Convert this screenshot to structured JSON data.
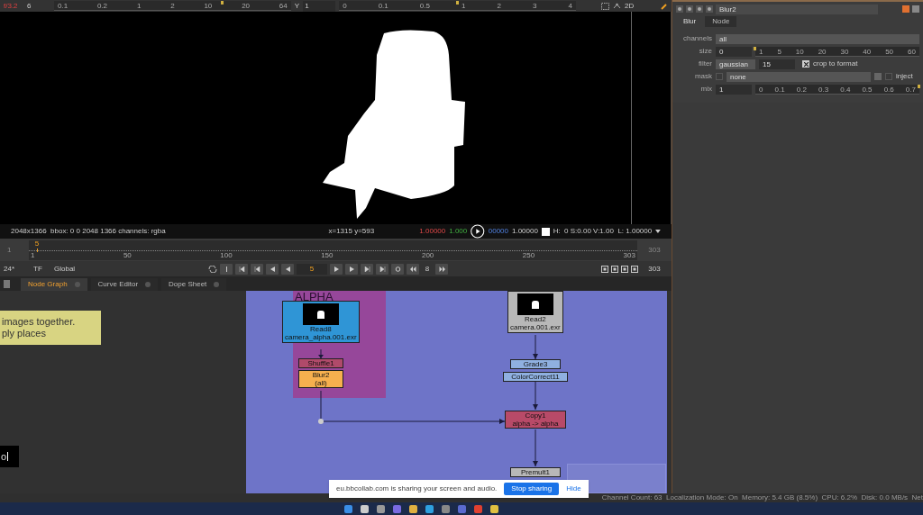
{
  "viewer_toolbar": {
    "fstop": "f/3.2",
    "frame_step": "6",
    "gain": {
      "ticks": [
        "0.1",
        "0.2",
        "1",
        "2",
        "10",
        "20",
        "64"
      ],
      "level": 0.71
    },
    "y_label": "Y",
    "y_value": "1",
    "gamma": {
      "ticks": [
        "0",
        "0.1",
        "0.5",
        "1",
        "2",
        "3",
        "4"
      ],
      "level": 0.5
    },
    "view_mode": "2D"
  },
  "viewer": {
    "info": "2048x1366  bbox: 0 0 2048 1366 channels: rgba",
    "coords": "x=1315 y=593",
    "pixel_values": [
      "1.00000",
      "1.000",
      "00000",
      "1.00000"
    ],
    "hsvl": "H:  0 S:0.00 V:1.00  L: 1.00000"
  },
  "timeline": {
    "start": "1",
    "ticks": [
      "1",
      "50",
      "100",
      "150",
      "200",
      "250",
      "303"
    ],
    "level": 0.013,
    "marker": "5",
    "end": "303"
  },
  "playback": {
    "fps": "24*",
    "tf": "TF",
    "range": "Global",
    "frame": "5",
    "increment": "8",
    "end": "303"
  },
  "tabs": [
    {
      "label": "Node Graph",
      "selected": true
    },
    {
      "label": "Curve Editor",
      "selected": false
    },
    {
      "label": "Dope Sheet",
      "selected": false
    }
  ],
  "sticky_note": {
    "lines": [
      "images together.",
      "ply places"
    ]
  },
  "terminal_text": "o",
  "backdrop": {
    "label": "ALPHA"
  },
  "nodes": [
    {
      "kind": "read",
      "name": "Read8",
      "sub": "camera_alpha.001.exr",
      "color": "#2f95d6"
    },
    {
      "kind": "op",
      "name": "Shuffle1",
      "color": "#b04a6a"
    },
    {
      "kind": "op",
      "name": "Blur2",
      "sub": "(all)",
      "color": "#f6b04e"
    },
    {
      "kind": "read",
      "name": "Read2",
      "sub": "camera.001.exr",
      "color": "#b8b8b8"
    },
    {
      "kind": "op",
      "name": "Grade3",
      "color": "#8fb0e0"
    },
    {
      "kind": "op",
      "name": "ColorCorrect11",
      "color": "#8fb0e0"
    },
    {
      "kind": "op",
      "name": "Copy1",
      "sub": "alpha -> alpha",
      "color": "#b84a68"
    },
    {
      "kind": "op",
      "name": "Premult1",
      "color": "#b8b8b8"
    }
  ],
  "properties": {
    "node_name": "Blur2",
    "tabs": [
      {
        "label": "Blur",
        "selected": true
      },
      {
        "label": "Node",
        "selected": false
      }
    ],
    "knobs": [
      {
        "kind": "dropdown",
        "label": "channels",
        "value": "all"
      },
      {
        "kind": "slider",
        "label": "size",
        "value": "0",
        "level": 0,
        "ticks": [
          "1",
          "5",
          "10",
          "20",
          "30",
          "40",
          "50",
          "60"
        ]
      },
      {
        "kind": "filter",
        "label": "filter",
        "value": "gaussian",
        "number": "15",
        "checkbox_label": "crop to format",
        "checked": true
      },
      {
        "kind": "mask",
        "label": "mask",
        "checked": false,
        "value": "none",
        "inject_label": "inject",
        "inject_checked": false
      },
      {
        "kind": "slider",
        "label": "mix",
        "value": "1",
        "level": 1,
        "ticks": [
          "0",
          "0.1",
          "0.2",
          "0.3",
          "0.4",
          "0.5",
          "0.6",
          "0.7"
        ]
      }
    ]
  },
  "status_bar": "Channel Count: 63  Localization Mode: On  Memory: 5.4 GB (8.5%)  CPU: 6.2%  Disk: 0.0 MB/s  Net",
  "share_notice": {
    "message": "eu.bbcollab.com is sharing your screen and audio.",
    "stop": "Stop sharing",
    "hide": "Hide"
  }
}
